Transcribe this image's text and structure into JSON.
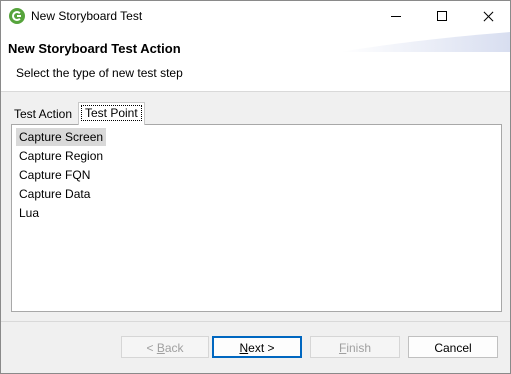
{
  "window": {
    "title": "New Storyboard Test"
  },
  "banner": {
    "title": "New Storyboard Test Action",
    "description": "Select the type of new test step"
  },
  "tabs": [
    {
      "label": "Test Action",
      "selected": false
    },
    {
      "label": "Test Point",
      "selected": true
    }
  ],
  "list": {
    "items": [
      "Capture Screen",
      "Capture Region",
      "Capture FQN",
      "Capture Data",
      "Lua"
    ],
    "selected_index": 0
  },
  "buttons": {
    "back": {
      "prefix": "< ",
      "mnemonic": "B",
      "rest": "ack",
      "enabled": false
    },
    "next": {
      "prefix": "",
      "mnemonic": "N",
      "rest": "ext >",
      "enabled": true,
      "default": true
    },
    "finish": {
      "prefix": "",
      "mnemonic": "F",
      "rest": "inish",
      "enabled": false
    },
    "cancel": {
      "label": "Cancel",
      "enabled": true
    }
  },
  "colors": {
    "accent": "#0067c0",
    "app_icon": "#56a43c",
    "selection": "#d9d9d9"
  },
  "icons": {
    "app": "app-logo-icon",
    "minimize": "minimize-icon",
    "maximize": "maximize-icon",
    "close": "close-icon"
  }
}
